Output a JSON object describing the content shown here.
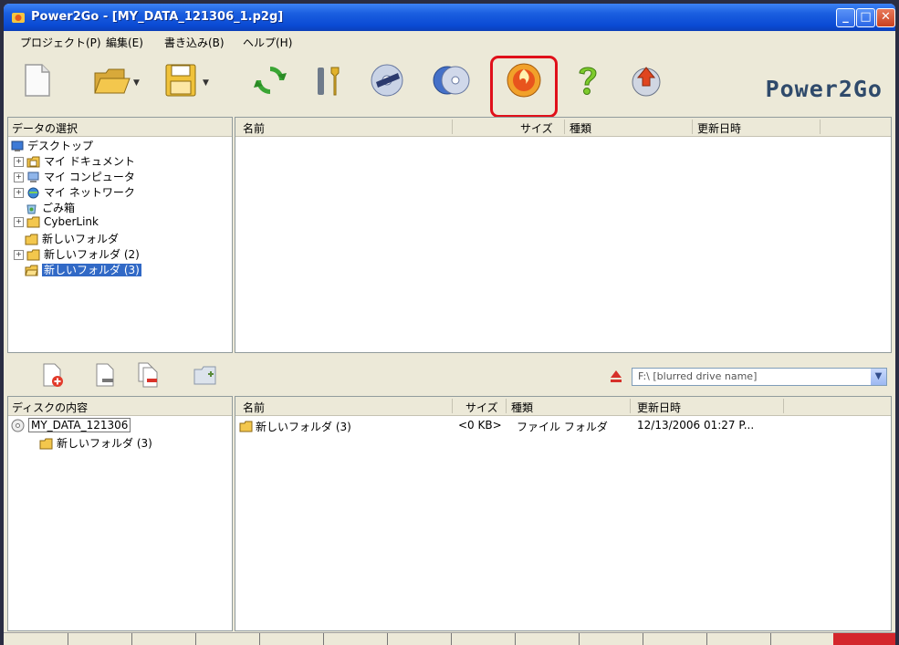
{
  "window": {
    "title": "Power2Go - [MY_DATA_121306_1.p2g]"
  },
  "menu": [
    "プロジェクト(P)",
    "編集(E)",
    "書き込み(B)",
    "ヘルプ(H)"
  ],
  "toolbar": {
    "brand": "Power2Go",
    "buttons": [
      "new-project",
      "open-project",
      "save-project",
      "refresh",
      "settings",
      "burn-disc",
      "copy-disc",
      "burn",
      "help",
      "upgrade"
    ],
    "highlighted_button": "burn"
  },
  "source_panel": {
    "header": "データの選択",
    "tree": [
      {
        "label": "デスクトップ",
        "icon": "desktop-icon",
        "level": 0,
        "expander": ""
      },
      {
        "label": "マイ ドキュメント",
        "icon": "my-documents-icon",
        "level": 1,
        "expander": "+"
      },
      {
        "label": "マイ コンピュータ",
        "icon": "my-computer-icon",
        "level": 1,
        "expander": "+"
      },
      {
        "label": "マイ ネットワーク",
        "icon": "network-icon",
        "level": 1,
        "expander": "+"
      },
      {
        "label": "ごみ箱",
        "icon": "recycle-bin-icon",
        "level": 1,
        "expander": ""
      },
      {
        "label": "CyberLink",
        "icon": "folder-icon",
        "level": 1,
        "expander": "+"
      },
      {
        "label": "新しいフォルダ",
        "icon": "folder-icon",
        "level": 1,
        "expander": ""
      },
      {
        "label": "新しいフォルダ (2)",
        "icon": "folder-icon",
        "level": 1,
        "expander": "+"
      },
      {
        "label": "新しいフォルダ (3)",
        "icon": "folder-open-icon",
        "level": 1,
        "expander": "",
        "selected": true
      }
    ]
  },
  "file_list": {
    "columns": [
      "名前",
      "サイズ",
      "種類",
      "更新日時"
    ],
    "rows": []
  },
  "disc_panel": {
    "header": "ディスクの内容",
    "tree": [
      {
        "label": "MY_DATA_121306",
        "icon": "disc-icon",
        "level": 0
      },
      {
        "label": "新しいフォルダ (3)",
        "icon": "folder-icon",
        "level": 1
      }
    ],
    "drive": "F:\\ [blurred drive name]"
  },
  "disc_list": {
    "columns": [
      "名前",
      "サイズ",
      "種類",
      "更新日時"
    ],
    "rows": [
      {
        "name": "新しいフォルダ (3)",
        "size": "<0 KB>",
        "type": "ファイル フォルダ",
        "modified": "12/13/2006 01:27 P..."
      }
    ]
  }
}
